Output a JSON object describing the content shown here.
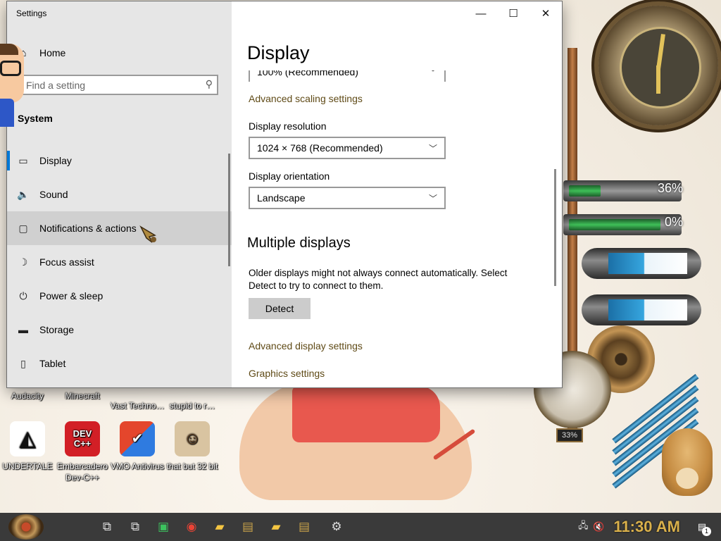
{
  "window": {
    "title": "Settings",
    "controls": {
      "minimize": "—",
      "maximize": "☐",
      "close": "✕"
    }
  },
  "sidebar": {
    "home_label": "Home",
    "search_placeholder": "Find a setting",
    "section": "System",
    "items": [
      {
        "label": "Display",
        "icon": "monitor-icon"
      },
      {
        "label": "Sound",
        "icon": "speaker-icon"
      },
      {
        "label": "Notifications & actions",
        "icon": "speech-bubble-icon"
      },
      {
        "label": "Focus assist",
        "icon": "moon-icon"
      },
      {
        "label": "Power & sleep",
        "icon": "power-icon"
      },
      {
        "label": "Storage",
        "icon": "drive-icon"
      },
      {
        "label": "Tablet",
        "icon": "tablet-icon"
      }
    ]
  },
  "main": {
    "title": "Display",
    "scale_value": "100% (Recommended)",
    "advanced_scaling": "Advanced scaling settings",
    "resolution_label": "Display resolution",
    "resolution_value": "1024 × 768 (Recommended)",
    "orientation_label": "Display orientation",
    "orientation_value": "Landscape",
    "multiple_heading": "Multiple displays",
    "multiple_text": "Older displays might not always connect automatically. Select Detect to try to connect to them.",
    "detect_button": "Detect",
    "advanced_display": "Advanced display settings",
    "graphics": "Graphics settings"
  },
  "desktop": {
    "gauge_top_pct": "36%",
    "gauge_bottom_pct": "0%",
    "meter_pct": "33%",
    "icons": [
      {
        "label": "UNDERTALE",
        "glyph": "◭"
      },
      {
        "label": "Embarcadero Dev-C++",
        "glyph_top": "DEV",
        "glyph_bottom": "C++"
      },
      {
        "label": "VMO Antivirus",
        "glyph": "✔"
      },
      {
        "label": "that but 32 bit",
        "glyph": "☺"
      }
    ],
    "row1_partial": [
      "Audacity",
      "Minecraft",
      "Vast Techno…",
      "stupid to r…"
    ]
  },
  "taskbar": {
    "clock": "11:30 AM",
    "notification_count": "1"
  }
}
